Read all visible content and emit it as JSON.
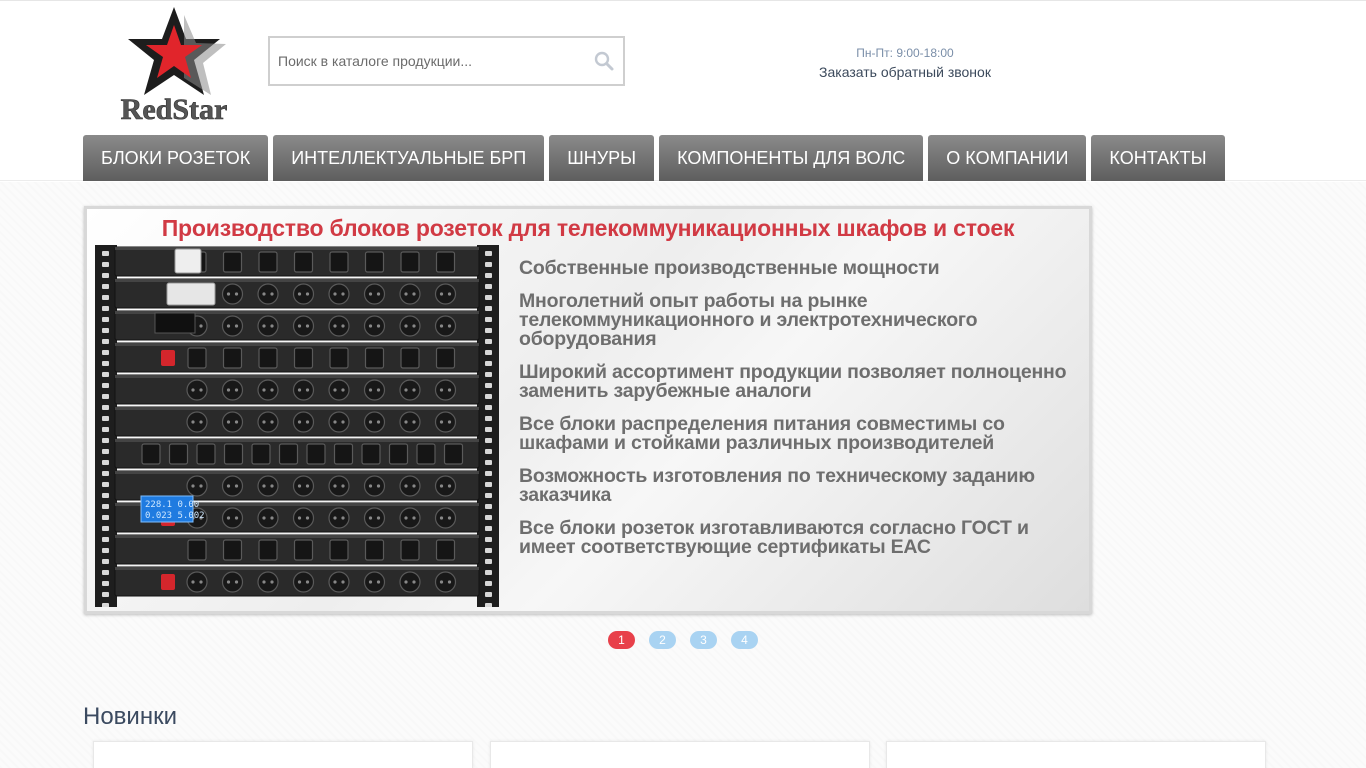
{
  "header": {
    "logo_text": "RedStar",
    "search": {
      "placeholder": "Поиск в каталоге продукции..."
    },
    "contact": {
      "hours": "Пн-Пт: 9:00-18:00",
      "callback_label": "Заказать обратный звонок"
    }
  },
  "nav": {
    "items": [
      {
        "label": "БЛОКИ РОЗЕТОК"
      },
      {
        "label": "ИНТЕЛЛЕКТУАЛЬНЫЕ БРП"
      },
      {
        "label": "ШНУРЫ"
      },
      {
        "label": "КОМПОНЕНТЫ ДЛЯ ВОЛС"
      },
      {
        "label": "О КОМПАНИИ"
      },
      {
        "label": "КОНТАКТЫ"
      }
    ]
  },
  "banner": {
    "title": "Производство блоков розеток для телекоммуникационных шкафов и стоек",
    "features": [
      {
        "text": "Собственные производственные мощности"
      },
      {
        "text": "Многолетний опыт работы на рынке телекоммуникационного и электротехнического оборудования"
      },
      {
        "text": "Широкий ассортимент продукции позволяет полноценно заменить зарубежные аналоги"
      },
      {
        "text": "Все блоки распределения питания совместимы со шкафами и стойками различных производителей"
      },
      {
        "text": "Возможность изготовления по техническому заданию заказчика"
      },
      {
        "text": "Все блоки розеток изготавливаются согласно ГОСТ и имеет соответствующие сертификаты ЕАС"
      }
    ],
    "meter_readings": [
      "228.1",
      "0.00",
      "0.023",
      "5.002"
    ]
  },
  "slider": {
    "pages": [
      "1",
      "2",
      "3",
      "4"
    ],
    "active_page": "1"
  },
  "news": {
    "title": "Новинки"
  },
  "colors": {
    "accent_red": "#e8404a",
    "dot_inactive": "#a9d3f2",
    "nav_bg": "#6e6e6e",
    "banner_title": "#d13a44"
  },
  "icons": {
    "search": "search-icon",
    "logo": "red-star-logo-icon"
  }
}
